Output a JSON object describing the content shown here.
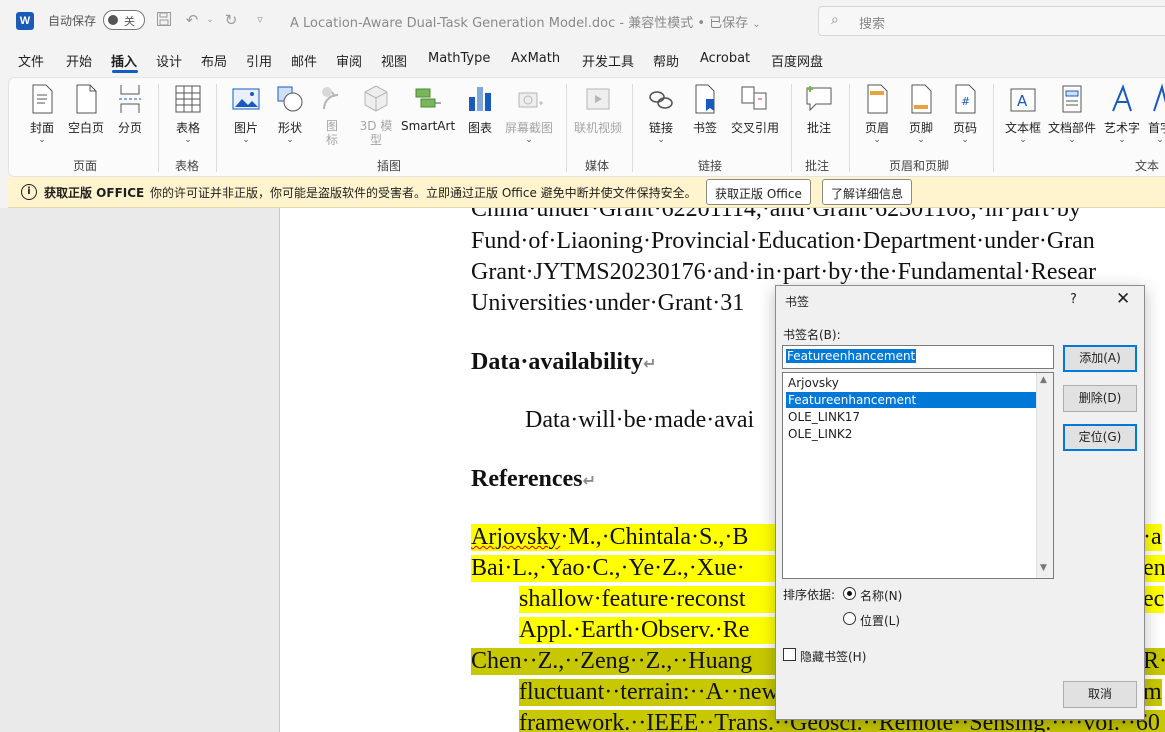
{
  "titlebar": {
    "logo": "W",
    "autosave_label": "自动保存",
    "autosave_state": "关",
    "document_title": "A Location-Aware Dual-Task Generation Model.doc  -  兼容性模式 • 已保存",
    "search_placeholder": "搜索"
  },
  "tabs": [
    "文件",
    "开始",
    "插入",
    "设计",
    "布局",
    "引用",
    "邮件",
    "审阅",
    "视图",
    "MathType",
    "AxMath",
    "开发工具",
    "帮助",
    "Acrobat",
    "百度网盘"
  ],
  "ribbon": {
    "cover": "封面",
    "blank_page": "空白页",
    "page_break": "分页",
    "table": "表格",
    "picture": "图片",
    "shapes": "形状",
    "icons": "图标",
    "model_3d": "3D 模型",
    "smartart": "SmartArt",
    "chart": "图表",
    "screenshot": "屏幕截图",
    "online_video": "联机视频",
    "link": "链接",
    "bookmark": "书签",
    "cross_ref": "交叉引用",
    "comment": "批注",
    "header": "页眉",
    "footer": "页脚",
    "page_number": "页码",
    "textbox": "文本框",
    "quick_parts": "文档部件",
    "wordart": "艺术字",
    "dropcap": "首字",
    "groups": {
      "pages": "页面",
      "tables": "表格",
      "illustrations": "插图",
      "media": "媒体",
      "links": "链接",
      "comments": "批注",
      "header_footer": "页眉和页脚",
      "text": "文本"
    }
  },
  "infobar": {
    "title": "获取正版 OFFICE",
    "message": "你的许可证并非正版，你可能是盗版软件的受害者。立即通过正版 Office 避免中断并使文件保持安全。",
    "btn_get": "获取正版 Office",
    "btn_learn": "了解详细信息"
  },
  "document": {
    "line1": "China·under·Grant·62201114,·and·Grant·62301108;·in·part·by",
    "line2": "Fund·of·Liaoning·Provincial·Education·Department·under·Gran",
    "line3": "Grant·JYTMS20230176·and·in·part·by·the·Fundamental·Resear",
    "line4": "Universities·under·Grant·31",
    "heading_data": "Data·availability",
    "data_text": "Data·will·be·made·avai",
    "heading_refs": "References",
    "ref1_author": "Arjovsky",
    "ref1_rest": "·M.,·Chintala·S.,·B",
    "ref1_tail": "·a",
    "ref2": "Bai·L.,·Yao·C.,·Ye·Z.,·Xue·",
    "ref2_tail": "en",
    "ref2_cont": "shallow·feature·reconst",
    "ref2_cont_tail": "ec",
    "ref2_cont2": "Appl.·Earth·Observ.·Re",
    "ref3": "Chen··Z.,··Zeng··Z.,··Huang",
    "ref3_tail": "R··",
    "ref3_cont": "fluctuant··terrain:··A··new",
    "ref3_cont_tail": "m",
    "ref3_cont2": "framework.··IEEE··Trans.··Geosci.··Remote··Sensing.····vol.··60"
  },
  "dialog": {
    "title": "书签",
    "help": "?",
    "name_label": "书签名(B):",
    "name_value": "Featureenhancement",
    "items": [
      "Arjovsky",
      "Featureenhancement",
      "OLE_LINK17",
      "OLE_LINK2"
    ],
    "selected_index": 1,
    "btn_add": "添加(A)",
    "btn_delete": "删除(D)",
    "btn_goto": "定位(G)",
    "sort_label": "排序依据:",
    "sort_name": "名称(N)",
    "sort_location": "位置(L)",
    "sort_selected": "名称",
    "hidden_label": "隐藏书签(H)",
    "hidden_checked": false,
    "btn_cancel": "取消"
  },
  "colors": {
    "accent": "#185abd",
    "highlight_yellow": "#ffff00",
    "highlight_olive": "#c8c800",
    "selection": "#0078d7",
    "infobar_bg": "#fff4ce"
  }
}
